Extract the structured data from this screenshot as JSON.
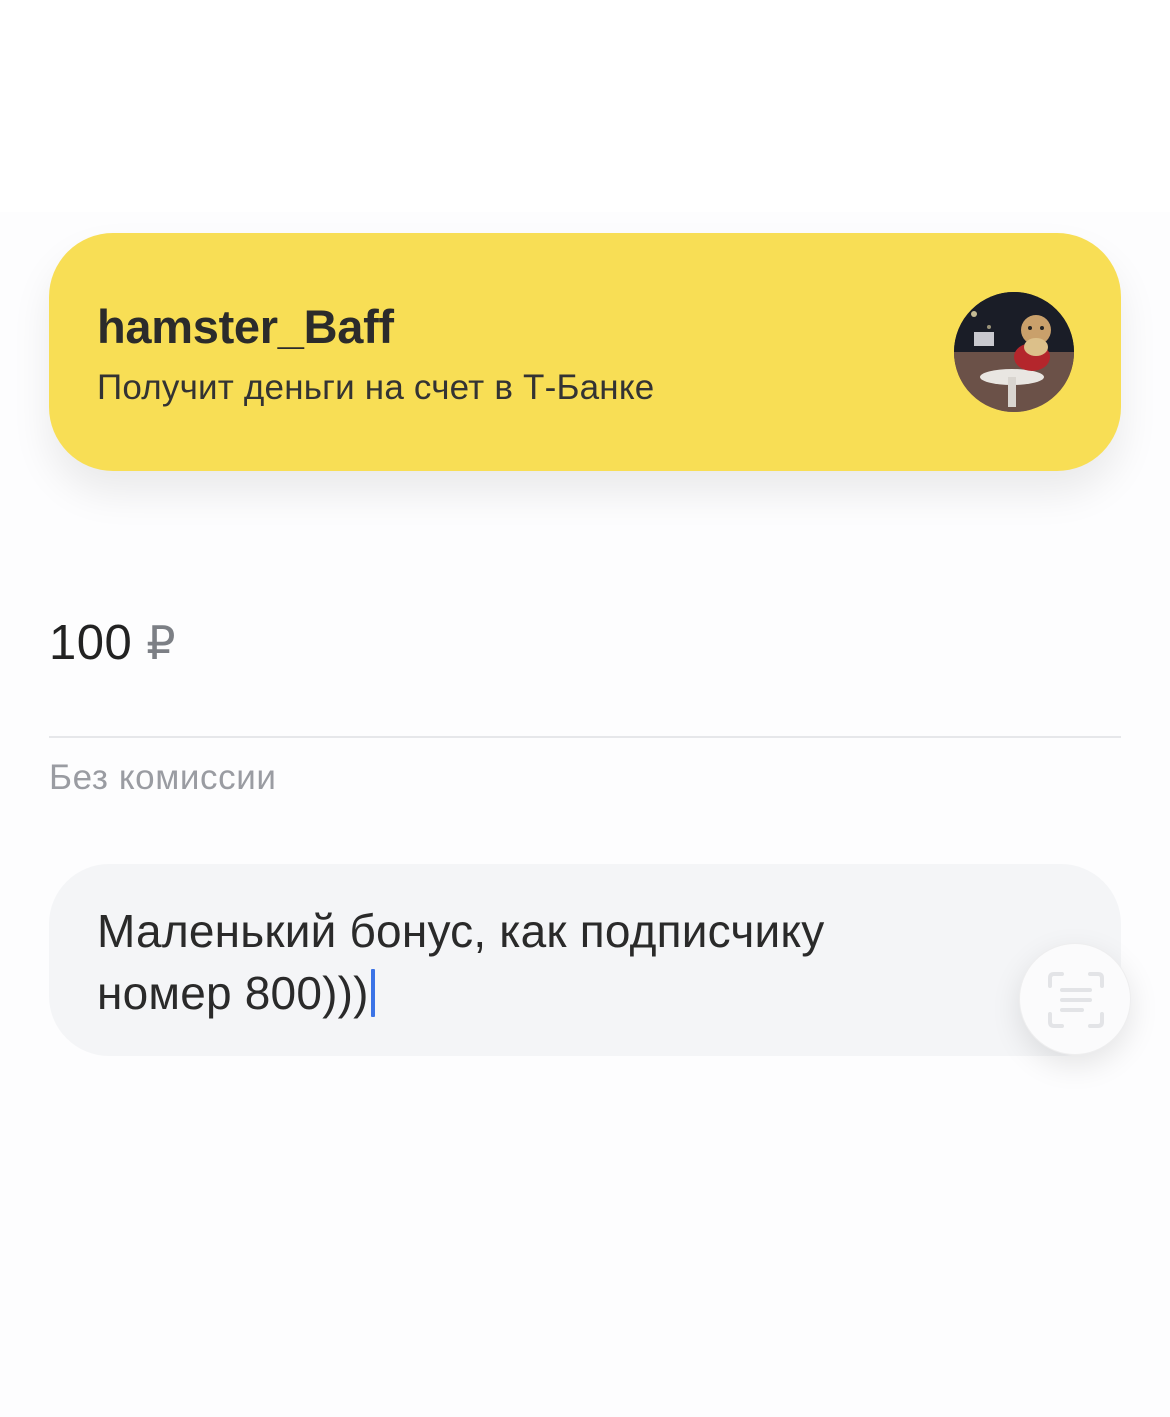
{
  "recipient": {
    "name": "hamster_Baff",
    "subtitle": "Получит деньги на счет в Т-Банке",
    "card_color": "#f8de55",
    "avatar_icon": "user-avatar-photo"
  },
  "amount": {
    "value": "100",
    "currency": "₽"
  },
  "fee_note": "Без комиссии",
  "message": {
    "line1": "Маленький бонус, как подписчику",
    "line2": "номер 800)))",
    "cursor_color": "#3b73e6"
  },
  "actions": {
    "scan_icon": "scan-text-icon"
  }
}
